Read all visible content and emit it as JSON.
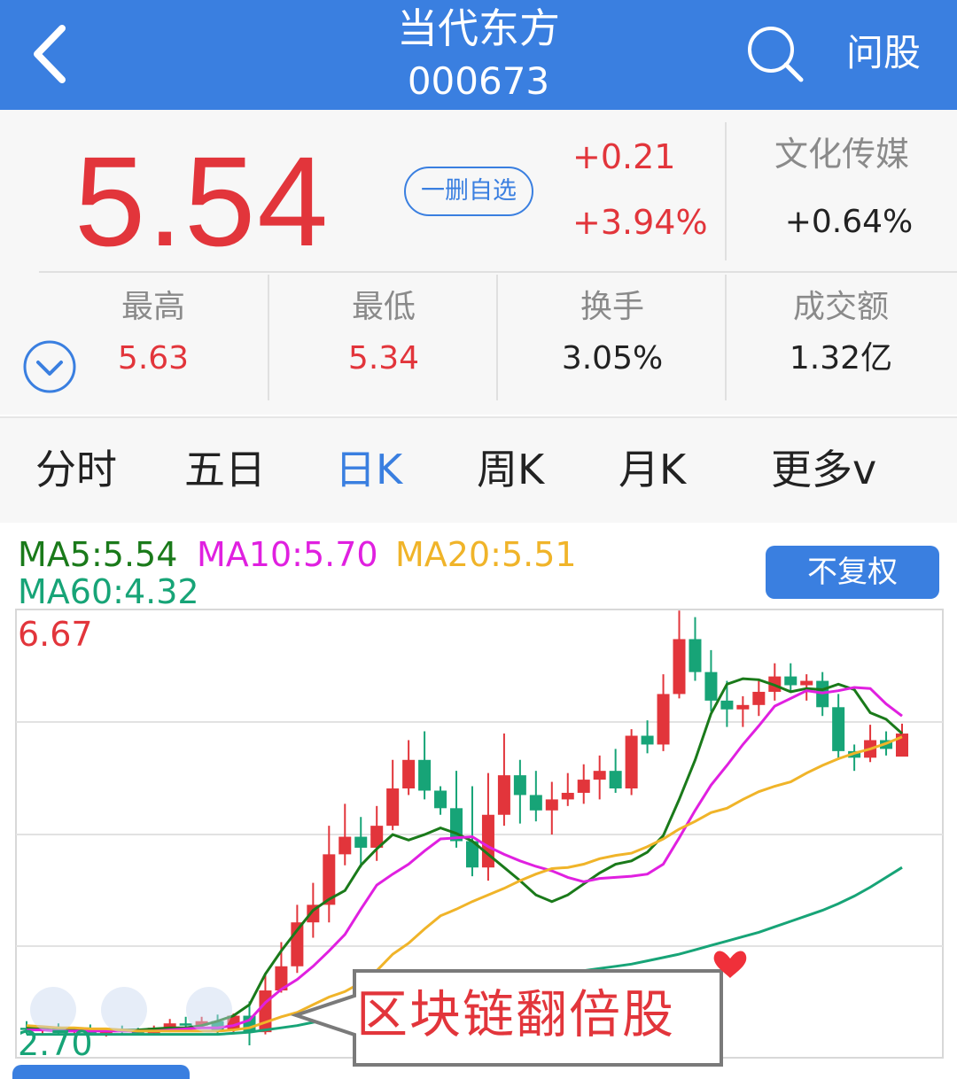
{
  "header": {
    "title": "当代东方",
    "code": "000673",
    "ask_label": "问股"
  },
  "quote": {
    "price": "5.54",
    "fav_button": "一删自选",
    "change": "+0.21",
    "change_pct": "+3.94%",
    "sector_name": "文化传媒",
    "sector_change": "+0.64%",
    "stats": [
      {
        "label": "最高",
        "value": "5.63"
      },
      {
        "label": "最低",
        "value": "5.34"
      },
      {
        "label": "换手",
        "value": "3.05%"
      },
      {
        "label": "成交额",
        "value": "1.32亿"
      }
    ]
  },
  "tabs": [
    {
      "label": "分时",
      "active": false
    },
    {
      "label": "五日",
      "active": false
    },
    {
      "label": "日K",
      "active": true
    },
    {
      "label": "周K",
      "active": false
    },
    {
      "label": "月K",
      "active": false
    },
    {
      "label": "更多v",
      "active": false
    }
  ],
  "chart": {
    "ma5": "MA5:5.54",
    "ma10": "MA10:5.70",
    "ma20": "MA20:5.51",
    "ma60": "MA60:4.32",
    "adjust_button": "不复权",
    "y_max_label": "6.67",
    "y_min_label": "2.70",
    "overlay_text": "区块链翻倍股"
  },
  "colors": {
    "brand": "#3a7fe0",
    "up": "#e2353b",
    "down": "#17a477",
    "ma5": "#1a7a1a",
    "ma10": "#e020e0",
    "ma20": "#f0b429",
    "ma60": "#17a477"
  },
  "chart_data": {
    "type": "candlestick",
    "ylim": [
      2.7,
      6.67
    ],
    "series": [
      {
        "name": "MA5",
        "values": [
          2.86,
          2.86,
          2.86,
          2.85,
          2.85,
          2.84,
          2.84,
          2.84,
          2.85,
          2.86,
          2.86,
          2.88,
          2.92,
          2.97,
          3.07,
          3.35,
          3.56,
          3.75,
          3.93,
          4.03,
          4.11,
          4.34,
          4.49,
          4.62,
          4.57,
          4.62,
          4.68,
          4.63,
          4.56,
          4.44,
          4.32,
          4.2,
          4.07,
          4.01,
          4.07,
          4.17,
          4.27,
          4.35,
          4.38,
          4.46,
          4.61,
          4.94,
          5.3,
          5.72,
          5.99,
          6.04,
          6.03,
          5.98,
          5.92,
          5.95,
          5.94,
          5.99,
          5.94,
          5.73,
          5.67,
          5.54
        ]
      },
      {
        "name": "MA10",
        "values": [
          2.84,
          2.84,
          2.83,
          2.83,
          2.83,
          2.83,
          2.83,
          2.83,
          2.83,
          2.84,
          2.85,
          2.86,
          2.86,
          2.88,
          2.93,
          3.09,
          3.21,
          3.3,
          3.42,
          3.56,
          3.71,
          3.94,
          4.16,
          4.26,
          4.35,
          4.47,
          4.58,
          4.59,
          4.6,
          4.51,
          4.44,
          4.38,
          4.33,
          4.29,
          4.23,
          4.19,
          4.22,
          4.23,
          4.24,
          4.26,
          4.35,
          4.59,
          4.84,
          5.07,
          5.25,
          5.44,
          5.61,
          5.79,
          5.86,
          5.93,
          5.91,
          5.93,
          5.96,
          5.95,
          5.81,
          5.7
        ]
      },
      {
        "name": "MA20",
        "values": [
          2.88,
          2.87,
          2.86,
          2.86,
          2.85,
          2.85,
          2.84,
          2.83,
          2.83,
          2.83,
          2.83,
          2.83,
          2.83,
          2.84,
          2.86,
          2.91,
          2.96,
          3.0,
          3.07,
          3.14,
          3.19,
          3.27,
          3.38,
          3.53,
          3.63,
          3.76,
          3.88,
          3.94,
          4.01,
          4.07,
          4.13,
          4.2,
          4.26,
          4.31,
          4.32,
          4.35,
          4.4,
          4.43,
          4.45,
          4.51,
          4.58,
          4.67,
          4.74,
          4.82,
          4.86,
          4.94,
          5.01,
          5.06,
          5.1,
          5.18,
          5.25,
          5.31,
          5.36,
          5.4,
          5.45,
          5.51
        ]
      },
      {
        "name": "MA60",
        "values": [
          2.8,
          2.8,
          2.8,
          2.8,
          2.8,
          2.8,
          2.8,
          2.8,
          2.8,
          2.8,
          2.8,
          2.8,
          2.8,
          2.81,
          2.82,
          2.84,
          2.86,
          2.88,
          2.91,
          2.94,
          2.97,
          3.01,
          3.05,
          3.09,
          3.13,
          3.16,
          3.19,
          3.22,
          3.24,
          3.26,
          3.28,
          3.3,
          3.32,
          3.34,
          3.36,
          3.38,
          3.4,
          3.42,
          3.44,
          3.47,
          3.5,
          3.53,
          3.57,
          3.61,
          3.65,
          3.69,
          3.73,
          3.78,
          3.83,
          3.88,
          3.93,
          3.99,
          4.06,
          4.14,
          4.23,
          4.32
        ]
      }
    ],
    "candles": [
      {
        "o": 2.86,
        "h": 2.92,
        "l": 2.8,
        "c": 2.84
      },
      {
        "o": 2.84,
        "h": 2.88,
        "l": 2.79,
        "c": 2.86
      },
      {
        "o": 2.86,
        "h": 2.9,
        "l": 2.8,
        "c": 2.82
      },
      {
        "o": 2.82,
        "h": 2.86,
        "l": 2.79,
        "c": 2.84
      },
      {
        "o": 2.84,
        "h": 2.89,
        "l": 2.8,
        "c": 2.81
      },
      {
        "o": 2.81,
        "h": 2.86,
        "l": 2.78,
        "c": 2.84
      },
      {
        "o": 2.84,
        "h": 2.88,
        "l": 2.8,
        "c": 2.83
      },
      {
        "o": 2.83,
        "h": 2.86,
        "l": 2.79,
        "c": 2.81
      },
      {
        "o": 2.81,
        "h": 2.88,
        "l": 2.79,
        "c": 2.86
      },
      {
        "o": 2.86,
        "h": 2.94,
        "l": 2.82,
        "c": 2.9
      },
      {
        "o": 2.9,
        "h": 2.96,
        "l": 2.84,
        "c": 2.88
      },
      {
        "o": 2.88,
        "h": 2.96,
        "l": 2.85,
        "c": 2.92
      },
      {
        "o": 2.92,
        "h": 2.98,
        "l": 2.8,
        "c": 2.84
      },
      {
        "o": 2.84,
        "h": 2.99,
        "l": 2.8,
        "c": 2.97
      },
      {
        "o": 2.97,
        "h": 3.1,
        "l": 2.7,
        "c": 2.82
      },
      {
        "o": 2.82,
        "h": 3.36,
        "l": 2.8,
        "c": 3.2
      },
      {
        "o": 3.2,
        "h": 3.64,
        "l": 3.18,
        "c": 3.42
      },
      {
        "o": 3.42,
        "h": 3.98,
        "l": 3.36,
        "c": 3.82
      },
      {
        "o": 3.82,
        "h": 4.18,
        "l": 3.68,
        "c": 3.98
      },
      {
        "o": 3.98,
        "h": 4.7,
        "l": 3.82,
        "c": 4.44
      },
      {
        "o": 4.44,
        "h": 4.9,
        "l": 4.34,
        "c": 4.6
      },
      {
        "o": 4.6,
        "h": 4.78,
        "l": 4.32,
        "c": 4.5
      },
      {
        "o": 4.5,
        "h": 4.88,
        "l": 4.38,
        "c": 4.7
      },
      {
        "o": 4.7,
        "h": 5.3,
        "l": 4.66,
        "c": 5.04
      },
      {
        "o": 5.04,
        "h": 5.48,
        "l": 4.98,
        "c": 5.3
      },
      {
        "o": 5.3,
        "h": 5.56,
        "l": 4.94,
        "c": 5.02
      },
      {
        "o": 5.02,
        "h": 5.06,
        "l": 4.8,
        "c": 4.86
      },
      {
        "o": 4.86,
        "h": 5.2,
        "l": 4.5,
        "c": 4.56
      },
      {
        "o": 4.56,
        "h": 5.06,
        "l": 4.24,
        "c": 4.32
      },
      {
        "o": 4.32,
        "h": 5.18,
        "l": 4.2,
        "c": 4.8
      },
      {
        "o": 4.8,
        "h": 5.54,
        "l": 4.7,
        "c": 5.16
      },
      {
        "o": 5.16,
        "h": 5.3,
        "l": 4.72,
        "c": 4.98
      },
      {
        "o": 4.98,
        "h": 5.2,
        "l": 4.74,
        "c": 4.84
      },
      {
        "o": 4.84,
        "h": 5.1,
        "l": 4.62,
        "c": 4.94
      },
      {
        "o": 4.94,
        "h": 5.18,
        "l": 4.88,
        "c": 5.0
      },
      {
        "o": 5.0,
        "h": 5.26,
        "l": 4.9,
        "c": 5.12
      },
      {
        "o": 5.12,
        "h": 5.34,
        "l": 4.94,
        "c": 5.2
      },
      {
        "o": 5.2,
        "h": 5.4,
        "l": 5.0,
        "c": 5.04
      },
      {
        "o": 5.04,
        "h": 5.58,
        "l": 4.98,
        "c": 5.52
      },
      {
        "o": 5.52,
        "h": 5.66,
        "l": 5.36,
        "c": 5.44
      },
      {
        "o": 5.44,
        "h": 6.08,
        "l": 5.38,
        "c": 5.9
      },
      {
        "o": 5.9,
        "h": 6.66,
        "l": 5.86,
        "c": 6.4
      },
      {
        "o": 6.4,
        "h": 6.6,
        "l": 6.02,
        "c": 6.1
      },
      {
        "o": 6.1,
        "h": 6.3,
        "l": 5.74,
        "c": 5.84
      },
      {
        "o": 5.84,
        "h": 6.02,
        "l": 5.6,
        "c": 5.76
      },
      {
        "o": 5.76,
        "h": 5.88,
        "l": 5.6,
        "c": 5.8
      },
      {
        "o": 5.8,
        "h": 6.02,
        "l": 5.7,
        "c": 5.92
      },
      {
        "o": 5.92,
        "h": 6.18,
        "l": 5.84,
        "c": 6.06
      },
      {
        "o": 6.06,
        "h": 6.18,
        "l": 5.92,
        "c": 5.98
      },
      {
        "o": 5.98,
        "h": 6.08,
        "l": 5.84,
        "c": 6.02
      },
      {
        "o": 6.02,
        "h": 6.1,
        "l": 5.7,
        "c": 5.78
      },
      {
        "o": 5.78,
        "h": 5.9,
        "l": 5.3,
        "c": 5.38
      },
      {
        "o": 5.38,
        "h": 5.44,
        "l": 5.2,
        "c": 5.32
      },
      {
        "o": 5.32,
        "h": 5.62,
        "l": 5.28,
        "c": 5.48
      },
      {
        "o": 5.48,
        "h": 5.56,
        "l": 5.34,
        "c": 5.4
      },
      {
        "o": 5.33,
        "h": 5.63,
        "l": 5.34,
        "c": 5.54
      }
    ]
  }
}
